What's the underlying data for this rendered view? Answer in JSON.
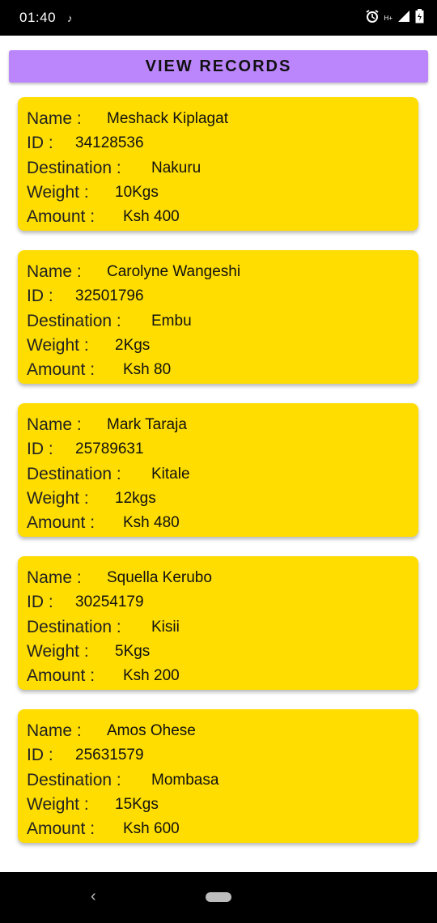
{
  "status_bar": {
    "time": "01:40",
    "network_label": "H+"
  },
  "header": {
    "button_label": "VIEW RECORDS"
  },
  "labels": {
    "name": "Name :",
    "id": "ID :",
    "destination": "Destination :",
    "weight": "Weight :",
    "amount": "Amount :"
  },
  "records": [
    {
      "name": "Meshack Kiplagat",
      "id": "34128536",
      "destination": "Nakuru",
      "weight": "10Kgs",
      "amount": "Ksh 400"
    },
    {
      "name": "Carolyne Wangeshi",
      "id": "32501796",
      "destination": "Embu",
      "weight": "2Kgs",
      "amount": "Ksh 80"
    },
    {
      "name": "Mark Taraja",
      "id": "25789631",
      "destination": "Kitale",
      "weight": "12kgs",
      "amount": "Ksh 480"
    },
    {
      "name": "Squella Kerubo",
      "id": "30254179",
      "destination": "Kisii",
      "weight": "5Kgs",
      "amount": "Ksh 200"
    },
    {
      "name": "Amos Ohese",
      "id": "25631579",
      "destination": "Mombasa",
      "weight": "15Kgs",
      "amount": "Ksh 600"
    }
  ],
  "colors": {
    "button": "#bb86fc",
    "card": "#ffdd00"
  }
}
